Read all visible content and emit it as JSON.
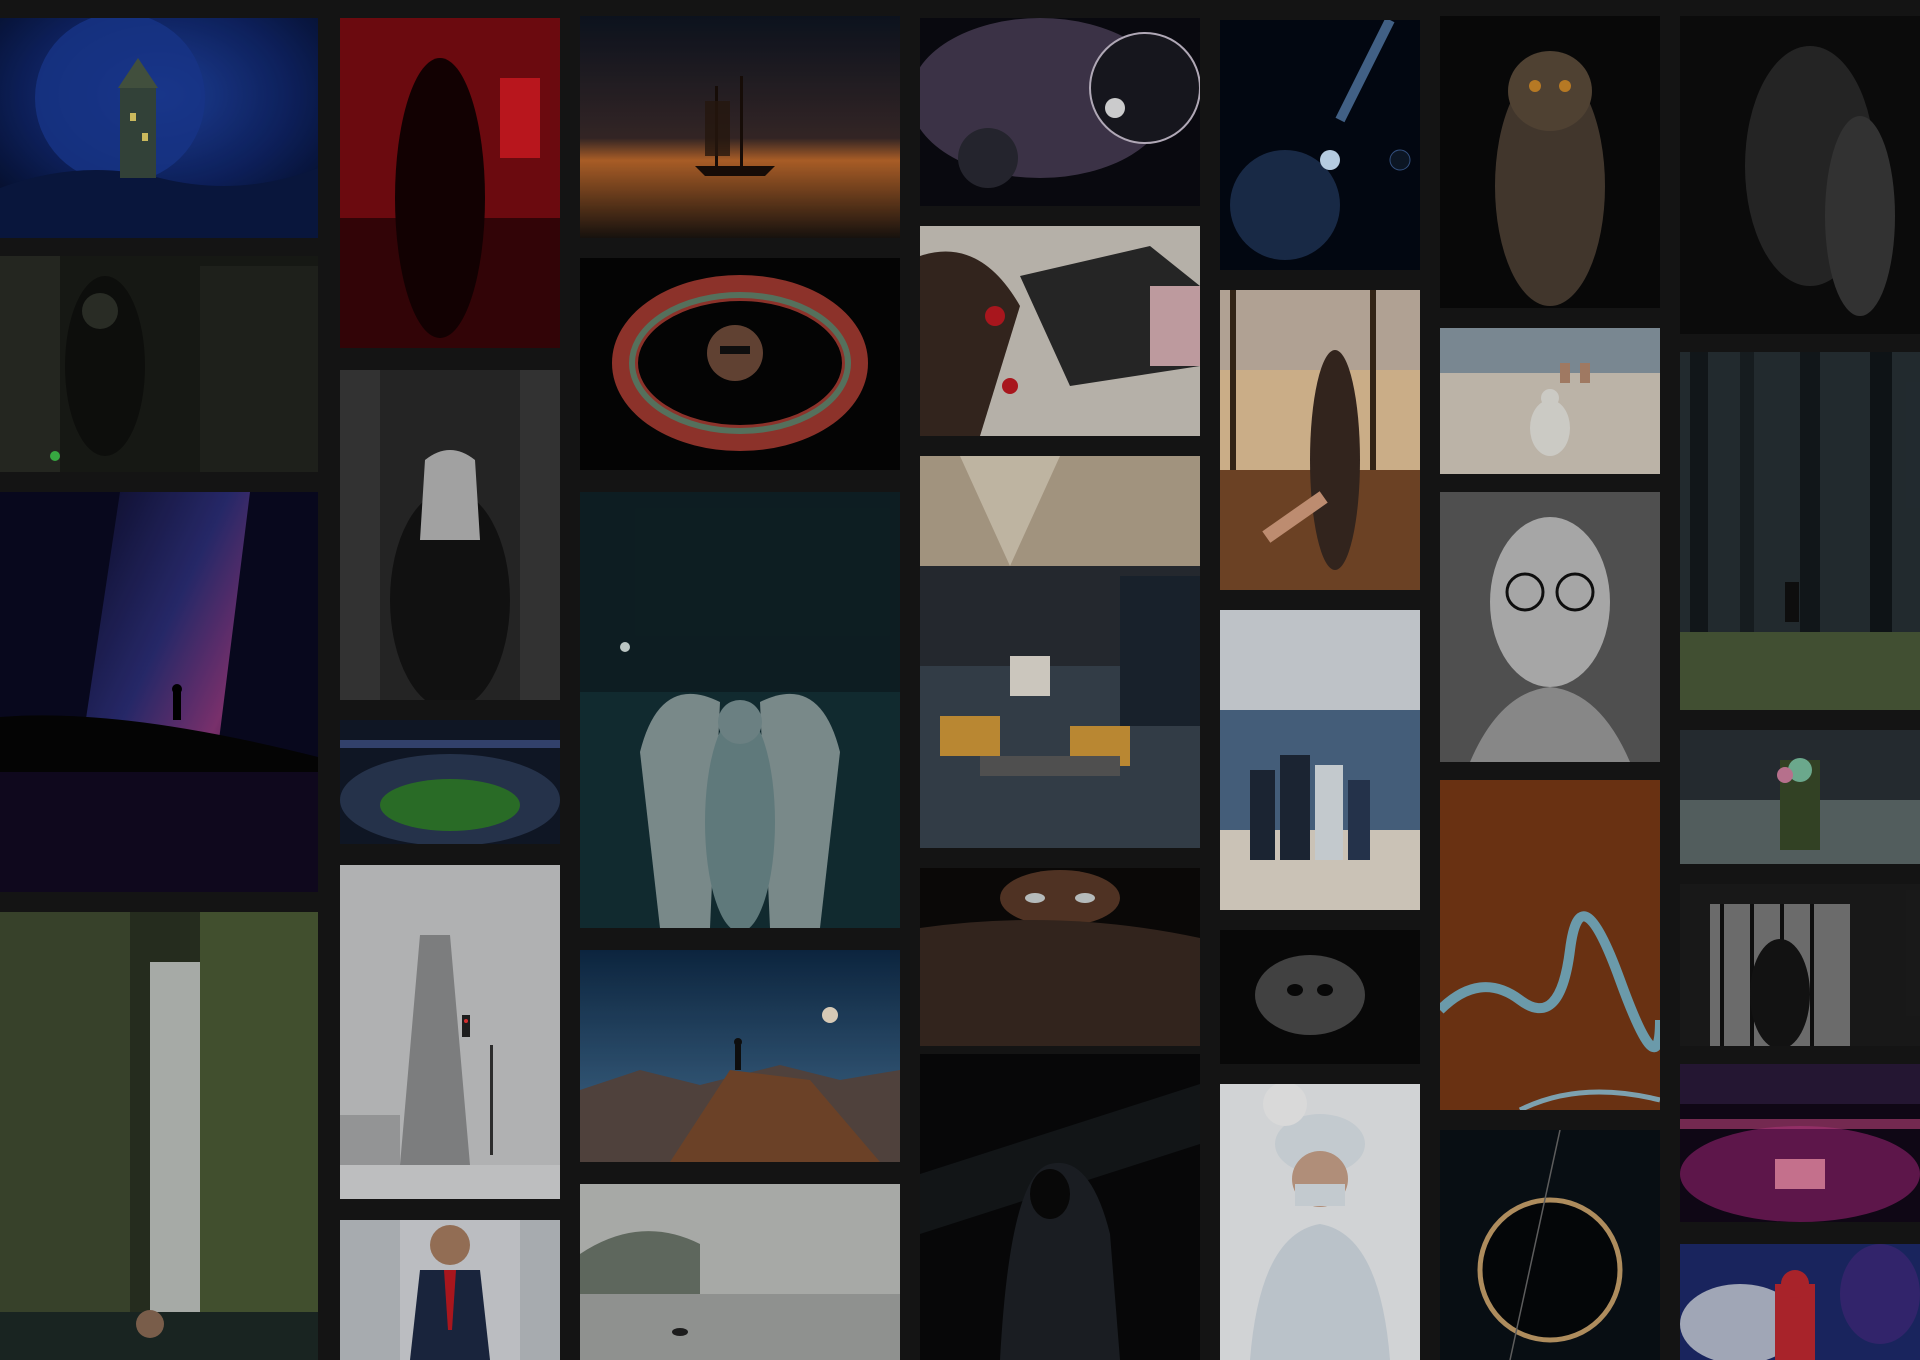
{
  "gallery": {
    "tiles": [
      {
        "subject": "fantasy-castle-moon",
        "palette": [
          "#0b1a3f",
          "#2146a8"
        ]
      },
      {
        "subject": "soldier-in-shadow",
        "palette": [
          "#141612",
          "#3a3d33"
        ]
      },
      {
        "subject": "milky-way-silhouette",
        "palette": [
          "#0a0a22",
          "#4a3d8f"
        ]
      },
      {
        "subject": "waterfall-jungle",
        "palette": [
          "#1a2015",
          "#6b7a55"
        ]
      },
      {
        "subject": "woman-red-room",
        "palette": [
          "#3b0508",
          "#b0101a"
        ]
      },
      {
        "subject": "hooded-figure-bw",
        "palette": [
          "#1a1a1a",
          "#7a7a7a"
        ]
      },
      {
        "subject": "stadium-night",
        "palette": [
          "#101830",
          "#2f7a2c"
        ]
      },
      {
        "subject": "flatiron-fog",
        "palette": [
          "#b9babb",
          "#e6e6e6"
        ]
      },
      {
        "subject": "businessman-suit",
        "palette": [
          "#d5d8dc",
          "#1d2a45"
        ]
      },
      {
        "subject": "ship-sunset",
        "palette": [
          "#0e1522",
          "#c06a2c"
        ]
      },
      {
        "subject": "man-glowing-ring",
        "palette": [
          "#050505",
          "#c7463b"
        ]
      },
      {
        "subject": "angel-statue-snow",
        "palette": [
          "#0f2227",
          "#6d8a8c"
        ]
      },
      {
        "subject": "hiker-mountain-peak",
        "palette": [
          "#0e2a47",
          "#7a4b2d"
        ]
      },
      {
        "subject": "misty-lake",
        "palette": [
          "#8e9290",
          "#c9cbc8"
        ]
      },
      {
        "subject": "space-planets",
        "palette": [
          "#0b0b12",
          "#a48db3"
        ]
      },
      {
        "subject": "woman-with-roses",
        "palette": [
          "#cfc9c0",
          "#2b2b2b"
        ]
      },
      {
        "subject": "restaurant-interior",
        "palette": [
          "#1c2632",
          "#d39a3a"
        ]
      },
      {
        "subject": "eyes-peeking",
        "palette": [
          "#0c0a09",
          "#6b4a35"
        ]
      },
      {
        "subject": "hooded-man-dark",
        "palette": [
          "#060708",
          "#22262b"
        ]
      },
      {
        "subject": "planet-comet",
        "palette": [
          "#030814",
          "#2c5a8f"
        ]
      },
      {
        "subject": "follow-me-autumn",
        "palette": [
          "#5a3b25",
          "#e6c59a"
        ]
      },
      {
        "subject": "family-beach",
        "palette": [
          "#c8cdd6",
          "#4e6a8a"
        ]
      },
      {
        "subject": "mask-closeup",
        "palette": [
          "#0a0a0a",
          "#9a9a9a"
        ]
      },
      {
        "subject": "surgeon",
        "palette": [
          "#e9ecef",
          "#b7c4cf"
        ]
      },
      {
        "subject": "owl-dark",
        "palette": [
          "#0a0a0a",
          "#5a4a3a"
        ]
      },
      {
        "subject": "seagull-beach",
        "palette": [
          "#c8bfb0",
          "#7a8a95"
        ]
      },
      {
        "subject": "bandaged-face-bw",
        "palette": [
          "#3a3a3a",
          "#a5a5a5"
        ]
      },
      {
        "subject": "river-autumn-aerial",
        "palette": [
          "#4a2512",
          "#7ab0c2"
        ]
      },
      {
        "subject": "eclipse-dark",
        "palette": [
          "#070b10",
          "#c7a06a"
        ]
      },
      {
        "subject": "silhouette-bodies",
        "palette": [
          "#0d0d0d",
          "#3a3a3a"
        ]
      },
      {
        "subject": "foggy-forest",
        "palette": [
          "#1a2125",
          "#4b5a4a"
        ]
      },
      {
        "subject": "hooded-green-mask",
        "palette": [
          "#1a2026",
          "#5e6a6a"
        ]
      },
      {
        "subject": "silhouette-bars",
        "palette": [
          "#1c1c1c",
          "#7a7a7a"
        ]
      },
      {
        "subject": "arena-lights",
        "palette": [
          "#120818",
          "#d04a8a"
        ]
      },
      {
        "subject": "smoke-red-hood",
        "palette": [
          "#1d2a6a",
          "#c02830"
        ]
      }
    ]
  }
}
